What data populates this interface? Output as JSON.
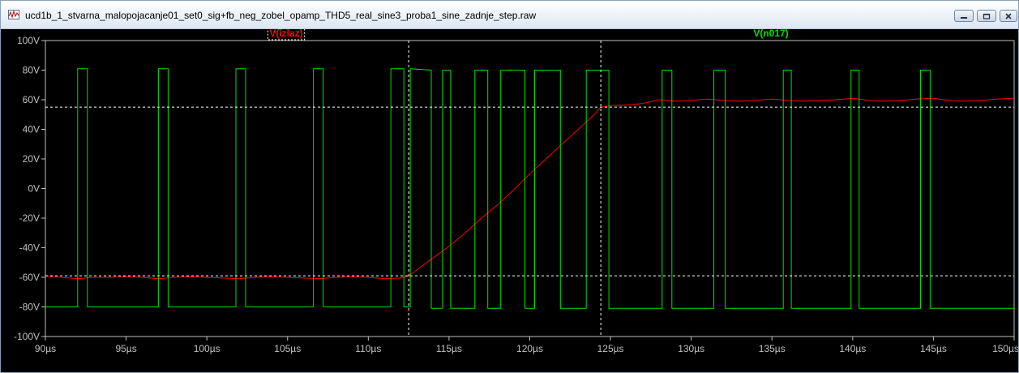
{
  "window": {
    "title": "ucd1b_1_stvarna_malopojacanje01_set0_sig+fb_neg_zobel_opamp_THD5_real_sine3_proba1_sine_zadnje_step.raw",
    "app_icon": "waveform-icon",
    "buttons": {
      "minimize": "minimize-icon",
      "maximize": "maximize-icon",
      "close": "close-icon"
    }
  },
  "chart_data": {
    "type": "line",
    "xlim": [
      90,
      150
    ],
    "ylim": [
      -100,
      100
    ],
    "x_ticks": [
      90,
      95,
      100,
      105,
      110,
      115,
      120,
      125,
      130,
      135,
      140,
      145,
      150
    ],
    "x_tick_labels": [
      "90µs",
      "95µs",
      "100µs",
      "105µs",
      "110µs",
      "115µs",
      "120µs",
      "125µs",
      "130µs",
      "135µs",
      "140µs",
      "145µs",
      "150µs"
    ],
    "y_ticks": [
      100,
      80,
      60,
      40,
      20,
      0,
      -20,
      -40,
      -60,
      -80,
      -100
    ],
    "y_tick_labels": [
      "100V",
      "80V",
      "60V",
      "40V",
      "20V",
      "0V",
      "-20V",
      "-40V",
      "-60V",
      "-80V",
      "-100V"
    ],
    "grid": false,
    "background": "#000000",
    "axis_color": "#c0c0c0",
    "cursors": {
      "x": [
        112.5,
        124.4
      ],
      "y": [
        55,
        -59
      ],
      "color": "#ffffff"
    },
    "series": [
      {
        "name": "V(izlaz)",
        "color": "#ff0000",
        "x": [
          90,
          91,
          92,
          93,
          94,
          95,
          96,
          97,
          98,
          99,
          100,
          101,
          102,
          103,
          104,
          105,
          106,
          107,
          108,
          109,
          110,
          111,
          112,
          112.5,
          113,
          114,
          115,
          116,
          117,
          118,
          119,
          120,
          121,
          122,
          123,
          124,
          124.4,
          125,
          126,
          127,
          128,
          129,
          130,
          131,
          132,
          133,
          134,
          135,
          136,
          137,
          138,
          139,
          140,
          141,
          142,
          143,
          144,
          145,
          146,
          147,
          148,
          149,
          150
        ],
        "y": [
          -59,
          -60,
          -61,
          -60,
          -60,
          -59.5,
          -60,
          -61,
          -60,
          -59.5,
          -60,
          -60.5,
          -61,
          -60,
          -59.5,
          -60,
          -60.5,
          -61,
          -60,
          -59.5,
          -60,
          -61,
          -60.5,
          -59,
          -55,
          -47,
          -39,
          -30,
          -20,
          -11,
          -1,
          10,
          20,
          30,
          40,
          50,
          55,
          56,
          56.5,
          57.5,
          60,
          59,
          59.5,
          60.5,
          59.5,
          59,
          59.5,
          60.5,
          59.5,
          59,
          59.5,
          60,
          61,
          59.5,
          59,
          59.5,
          60.5,
          61,
          59.5,
          59,
          59.5,
          60.5,
          61
        ]
      },
      {
        "name": "V(n017)",
        "color": "#00e000",
        "x": [
          90,
          92,
          92,
          92.6,
          92.6,
          97,
          97,
          97.6,
          97.6,
          101.8,
          101.8,
          102.4,
          102.4,
          106.6,
          106.6,
          107.2,
          107.2,
          111.4,
          111.4,
          112.2,
          112.2,
          112.6,
          112.6,
          113.9,
          113.9,
          114.6,
          114.6,
          115.1,
          115.1,
          116.6,
          116.6,
          117.4,
          117.4,
          118.2,
          118.2,
          119.7,
          119.7,
          120.3,
          120.3,
          121.9,
          121.9,
          123.5,
          123.5,
          124.9,
          124.9,
          128.2,
          128.2,
          128.8,
          128.8,
          131.4,
          131.4,
          132.1,
          132.1,
          135.7,
          135.7,
          136.2,
          136.2,
          139.9,
          139.9,
          140.4,
          140.4,
          144.2,
          144.2,
          144.8,
          144.8,
          150
        ],
        "y": [
          -80,
          -80,
          81,
          81,
          -80,
          -80,
          81,
          81,
          -80,
          -80,
          81,
          81,
          -80,
          -80,
          81,
          81,
          -80,
          -80,
          81,
          81,
          -80,
          -80,
          81,
          80,
          -81,
          -81,
          80,
          80,
          -81,
          -81,
          80,
          80,
          -81,
          -81,
          80,
          80,
          -81,
          -81,
          80,
          80,
          -81,
          -81,
          80,
          80,
          -81,
          -81,
          80,
          80,
          -81,
          -81,
          80,
          80,
          -81,
          -81,
          80,
          80,
          -81,
          -81,
          80,
          80,
          -81,
          -81,
          80,
          80,
          -81,
          -81
        ]
      }
    ]
  }
}
